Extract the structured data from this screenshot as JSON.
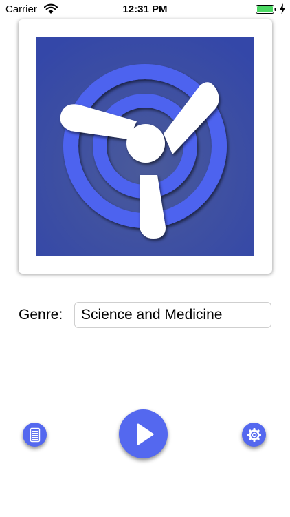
{
  "status_bar": {
    "carrier": "Carrier",
    "time": "12:31 PM",
    "battery_color": "#4cd964"
  },
  "artwork": {
    "icon": "radio-fan-logo-icon",
    "background_color": "#3d4fa8",
    "ring_color": "#4e63ef"
  },
  "genre": {
    "label": "Genre:",
    "value": "Science and Medicine"
  },
  "controls": {
    "list_icon": "list-icon",
    "play_icon": "play-icon",
    "settings_icon": "gear-icon",
    "accent_color": "#5468ef"
  }
}
